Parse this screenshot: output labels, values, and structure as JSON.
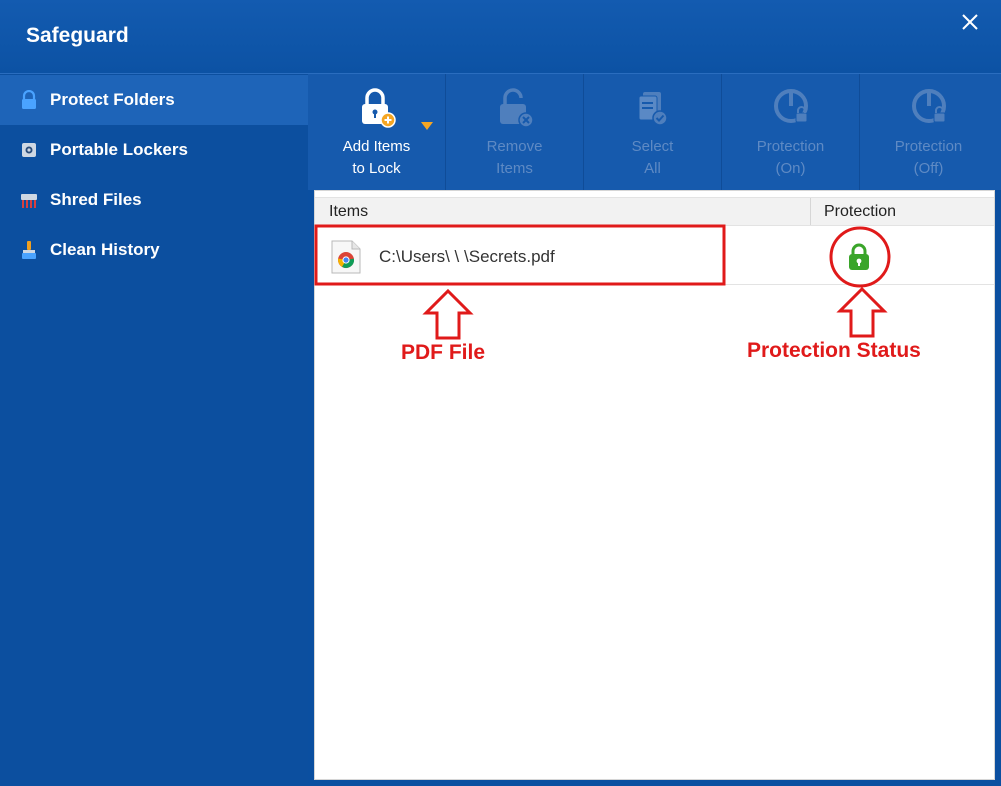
{
  "window": {
    "title": "Safeguard"
  },
  "sidebar": {
    "items": [
      {
        "label": "Protect Folders",
        "active": true
      },
      {
        "label": "Portable Lockers",
        "active": false
      },
      {
        "label": "Shred Files",
        "active": false
      },
      {
        "label": "Clean History",
        "active": false
      }
    ]
  },
  "toolbar": {
    "add_items": "Add Items\nto Lock",
    "remove_items": "Remove\nItems",
    "select_all": "Select\nAll",
    "protection_on": "Protection\n(On)",
    "protection_off": "Protection\n(Off)"
  },
  "table": {
    "columns": {
      "items": "Items",
      "protection": "Protection"
    },
    "rows": [
      {
        "path": "C:\\Users\\      \\      \\Secrets.pdf",
        "protection": "locked"
      }
    ]
  },
  "annotations": {
    "pdf_label": "PDF File",
    "status_label": "Protection Status",
    "color": "#e01a1a"
  },
  "colors": {
    "titlebar": "#135bb0",
    "sidebar": "#0c4f9f",
    "active_nav": "#1e64b8",
    "toolbar": "#165aad",
    "lock_green": "#3aa52a"
  }
}
